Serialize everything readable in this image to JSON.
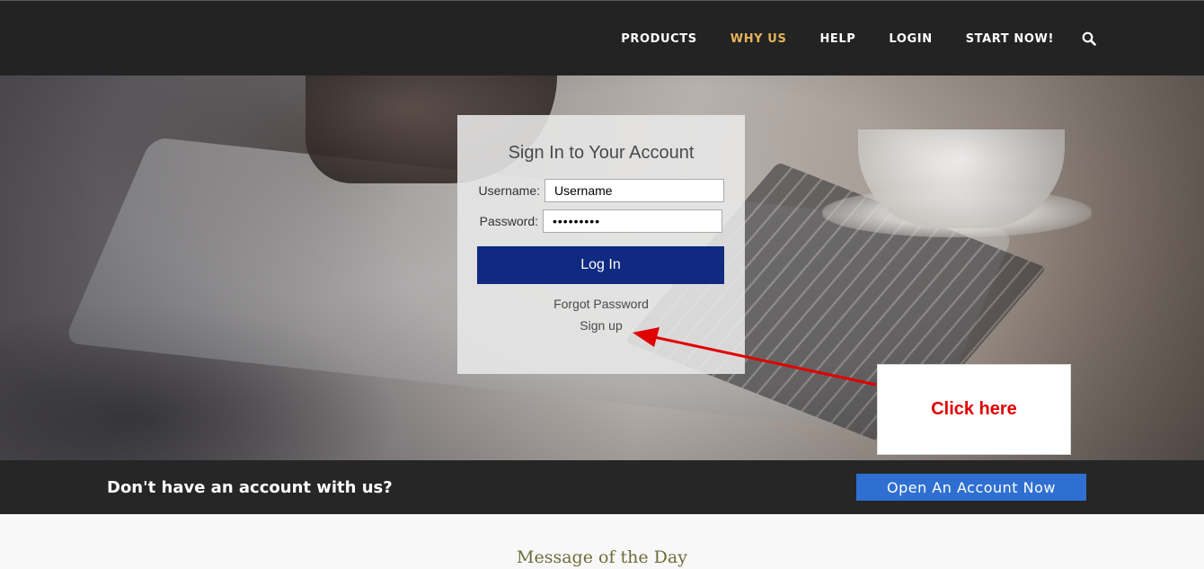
{
  "nav": {
    "items": [
      {
        "label": "PRODUCTS"
      },
      {
        "label": "WHY US",
        "active": true
      },
      {
        "label": "HELP"
      },
      {
        "label": "LOGIN"
      },
      {
        "label": "START NOW!"
      }
    ],
    "search_icon": "search-icon",
    "active_color": "#e6b35a",
    "background": "#232323"
  },
  "signin": {
    "title": "Sign In to Your Account",
    "username_label": "Username:",
    "username_value": "Username",
    "password_label": "Password:",
    "password_value": "•••••••••",
    "login_label": "Log In",
    "login_color": "#0f2a80",
    "forgot_label": "Forgot Password",
    "signup_label": "Sign up"
  },
  "annotation": {
    "callout_text": "Click here",
    "color": "#e00000"
  },
  "account_band": {
    "text": "Don't have an account with us?",
    "button_label": "Open An Account Now",
    "button_color": "#2f6fd1"
  },
  "motd": {
    "title": "Message of the Day"
  }
}
